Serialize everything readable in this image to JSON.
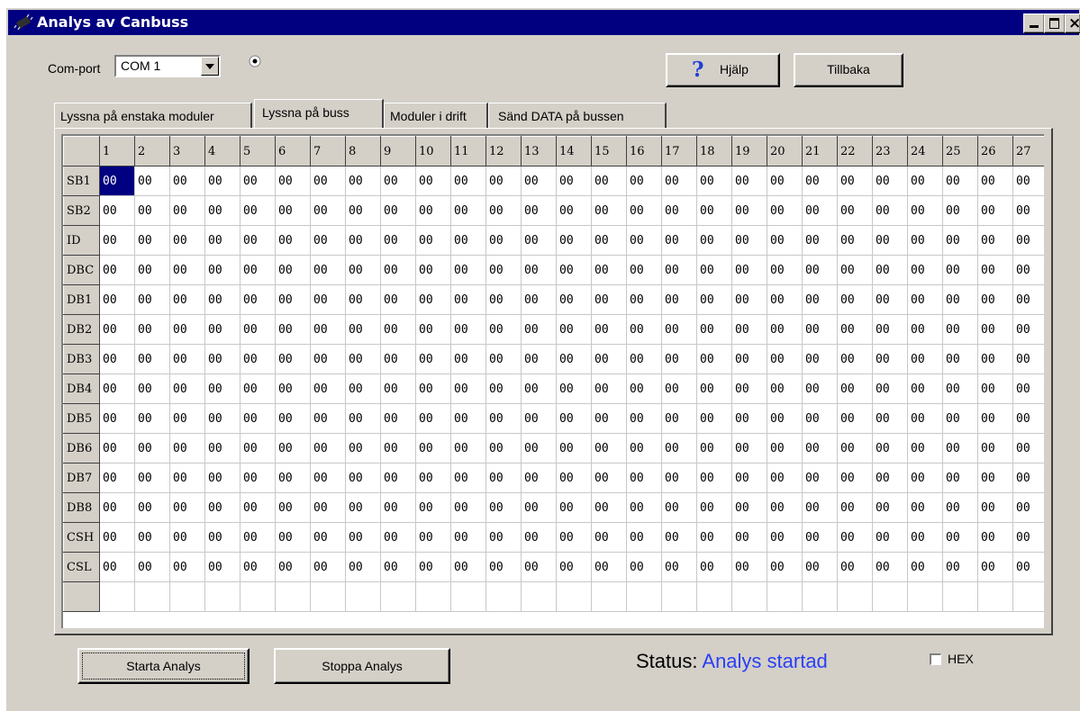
{
  "window": {
    "title": "Analys av Canbuss",
    "icon": "chip-icon",
    "controls": [
      "minimize",
      "maximize",
      "close"
    ]
  },
  "toolbar": {
    "comport_label": "Com-port",
    "comport_value": "COM 1",
    "help_label": "Hjälp",
    "help_icon": "question-icon",
    "back_label": "Tillbaka"
  },
  "tabs": [
    {
      "label": "Lyssna på enstaka moduler",
      "active": false
    },
    {
      "label": "Lyssna på buss",
      "active": true
    },
    {
      "label": "Moduler i drift",
      "active": false
    },
    {
      "label": "Sänd DATA på bussen",
      "active": false
    }
  ],
  "grid": {
    "columns": [
      "1",
      "2",
      "3",
      "4",
      "5",
      "6",
      "7",
      "8",
      "9",
      "10",
      "11",
      "12",
      "13",
      "14",
      "15",
      "16",
      "17",
      "18",
      "19",
      "20",
      "21",
      "22",
      "23",
      "24",
      "25",
      "26",
      "27"
    ],
    "rows": [
      {
        "label": "SB1",
        "values": [
          "00",
          "00",
          "00",
          "00",
          "00",
          "00",
          "00",
          "00",
          "00",
          "00",
          "00",
          "00",
          "00",
          "00",
          "00",
          "00",
          "00",
          "00",
          "00",
          "00",
          "00",
          "00",
          "00",
          "00",
          "00",
          "00",
          "00"
        ]
      },
      {
        "label": "SB2",
        "values": [
          "00",
          "00",
          "00",
          "00",
          "00",
          "00",
          "00",
          "00",
          "00",
          "00",
          "00",
          "00",
          "00",
          "00",
          "00",
          "00",
          "00",
          "00",
          "00",
          "00",
          "00",
          "00",
          "00",
          "00",
          "00",
          "00",
          "00"
        ]
      },
      {
        "label": "ID",
        "values": [
          "00",
          "00",
          "00",
          "00",
          "00",
          "00",
          "00",
          "00",
          "00",
          "00",
          "00",
          "00",
          "00",
          "00",
          "00",
          "00",
          "00",
          "00",
          "00",
          "00",
          "00",
          "00",
          "00",
          "00",
          "00",
          "00",
          "00"
        ]
      },
      {
        "label": "DBC",
        "values": [
          "00",
          "00",
          "00",
          "00",
          "00",
          "00",
          "00",
          "00",
          "00",
          "00",
          "00",
          "00",
          "00",
          "00",
          "00",
          "00",
          "00",
          "00",
          "00",
          "00",
          "00",
          "00",
          "00",
          "00",
          "00",
          "00",
          "00"
        ]
      },
      {
        "label": "DB1",
        "values": [
          "00",
          "00",
          "00",
          "00",
          "00",
          "00",
          "00",
          "00",
          "00",
          "00",
          "00",
          "00",
          "00",
          "00",
          "00",
          "00",
          "00",
          "00",
          "00",
          "00",
          "00",
          "00",
          "00",
          "00",
          "00",
          "00",
          "00"
        ]
      },
      {
        "label": "DB2",
        "values": [
          "00",
          "00",
          "00",
          "00",
          "00",
          "00",
          "00",
          "00",
          "00",
          "00",
          "00",
          "00",
          "00",
          "00",
          "00",
          "00",
          "00",
          "00",
          "00",
          "00",
          "00",
          "00",
          "00",
          "00",
          "00",
          "00",
          "00"
        ]
      },
      {
        "label": "DB3",
        "values": [
          "00",
          "00",
          "00",
          "00",
          "00",
          "00",
          "00",
          "00",
          "00",
          "00",
          "00",
          "00",
          "00",
          "00",
          "00",
          "00",
          "00",
          "00",
          "00",
          "00",
          "00",
          "00",
          "00",
          "00",
          "00",
          "00",
          "00"
        ]
      },
      {
        "label": "DB4",
        "values": [
          "00",
          "00",
          "00",
          "00",
          "00",
          "00",
          "00",
          "00",
          "00",
          "00",
          "00",
          "00",
          "00",
          "00",
          "00",
          "00",
          "00",
          "00",
          "00",
          "00",
          "00",
          "00",
          "00",
          "00",
          "00",
          "00",
          "00"
        ]
      },
      {
        "label": "DB5",
        "values": [
          "00",
          "00",
          "00",
          "00",
          "00",
          "00",
          "00",
          "00",
          "00",
          "00",
          "00",
          "00",
          "00",
          "00",
          "00",
          "00",
          "00",
          "00",
          "00",
          "00",
          "00",
          "00",
          "00",
          "00",
          "00",
          "00",
          "00"
        ]
      },
      {
        "label": "DB6",
        "values": [
          "00",
          "00",
          "00",
          "00",
          "00",
          "00",
          "00",
          "00",
          "00",
          "00",
          "00",
          "00",
          "00",
          "00",
          "00",
          "00",
          "00",
          "00",
          "00",
          "00",
          "00",
          "00",
          "00",
          "00",
          "00",
          "00",
          "00"
        ]
      },
      {
        "label": "DB7",
        "values": [
          "00",
          "00",
          "00",
          "00",
          "00",
          "00",
          "00",
          "00",
          "00",
          "00",
          "00",
          "00",
          "00",
          "00",
          "00",
          "00",
          "00",
          "00",
          "00",
          "00",
          "00",
          "00",
          "00",
          "00",
          "00",
          "00",
          "00"
        ]
      },
      {
        "label": "DB8",
        "values": [
          "00",
          "00",
          "00",
          "00",
          "00",
          "00",
          "00",
          "00",
          "00",
          "00",
          "00",
          "00",
          "00",
          "00",
          "00",
          "00",
          "00",
          "00",
          "00",
          "00",
          "00",
          "00",
          "00",
          "00",
          "00",
          "00",
          "00"
        ]
      },
      {
        "label": "CSH",
        "values": [
          "00",
          "00",
          "00",
          "00",
          "00",
          "00",
          "00",
          "00",
          "00",
          "00",
          "00",
          "00",
          "00",
          "00",
          "00",
          "00",
          "00",
          "00",
          "00",
          "00",
          "00",
          "00",
          "00",
          "00",
          "00",
          "00",
          "00"
        ]
      },
      {
        "label": "CSL",
        "values": [
          "00",
          "00",
          "00",
          "00",
          "00",
          "00",
          "00",
          "00",
          "00",
          "00",
          "00",
          "00",
          "00",
          "00",
          "00",
          "00",
          "00",
          "00",
          "00",
          "00",
          "00",
          "00",
          "00",
          "00",
          "00",
          "00",
          "00"
        ]
      },
      {
        "label": "",
        "values": [
          "",
          "",
          "",
          "",
          "",
          "",
          "",
          "",
          "",
          "",
          "",
          "",
          "",
          "",
          "",
          "",
          "",
          "",
          "",
          "",
          "",
          "",
          "",
          "",
          "",
          "",
          ""
        ]
      }
    ]
  },
  "bottom": {
    "start_label": "Starta Analys",
    "stop_label": "Stoppa Analys",
    "status_label": "Status:",
    "status_value": "Analys startad",
    "hex_label": "HEX",
    "hex_checked": false
  },
  "colors": {
    "titlebar": "#000080",
    "face": "#d4d0c8",
    "status_value": "#2a3ff5",
    "selection": "#000080"
  }
}
